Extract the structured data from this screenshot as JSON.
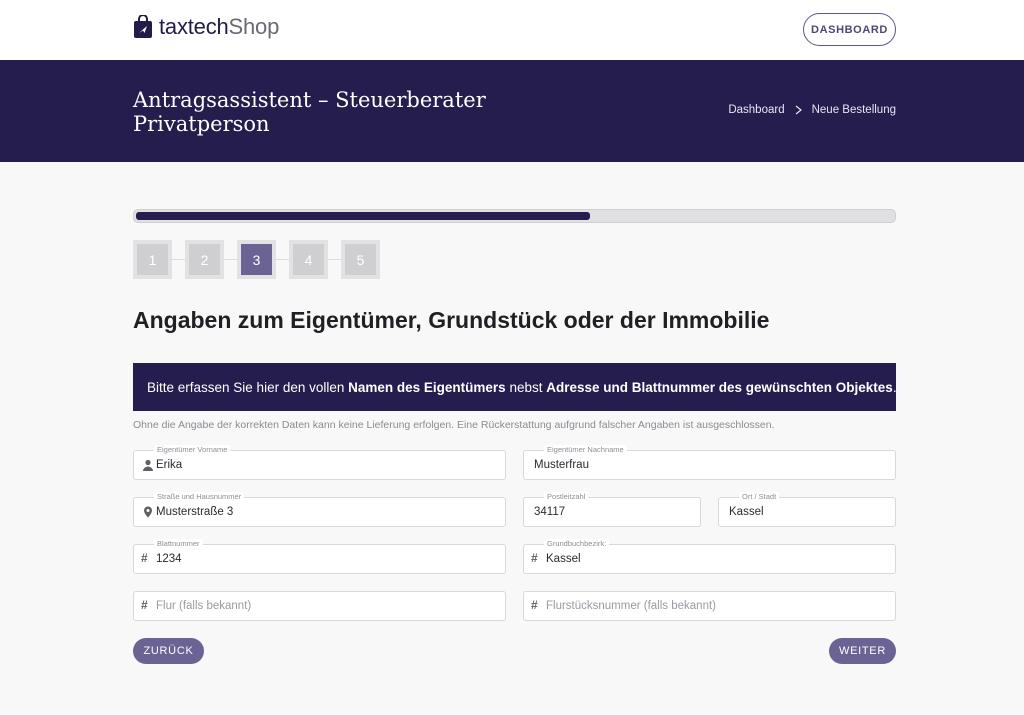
{
  "header": {
    "logo_bold": "taxtech",
    "logo_light": "Shop",
    "dashboard_button": "DASHBOARD"
  },
  "hero": {
    "title": "Antragsassistent – Steuerberater Privatperson",
    "breadcrumb": [
      "Dashboard",
      "Neue Bestellung"
    ]
  },
  "progress": {
    "fraction": 0.6
  },
  "steps": {
    "items": [
      "1",
      "2",
      "3",
      "4",
      "5"
    ],
    "active": 3
  },
  "section": {
    "title": "Angaben zum Eigentümer, Grundstück oder der Immobilie"
  },
  "info": {
    "part1": "Bitte erfassen Sie hier den vollen ",
    "bold1": "Namen des Eigentümers",
    "part2": " nebst ",
    "bold2": "Adresse und Blattnummer des gewünschten Objektes",
    "part3": "."
  },
  "note": "Ohne die Angabe der korrekten Daten kann keine Lieferung erfolgen. Eine Rückerstattung aufgrund falscher Angaben ist ausgeschlossen.",
  "form": {
    "vorname": {
      "label": "Eigentümer Vorname",
      "value": "Erika",
      "icon": "user-icon"
    },
    "nachname": {
      "label": "Eigentümer Nachname",
      "value": "Musterfrau"
    },
    "strasse": {
      "label": "Straße und Hausnummer",
      "value": "Musterstraße 3",
      "icon": "location-pin-icon"
    },
    "plz": {
      "label": "Postleitzahl",
      "value": "34117"
    },
    "ort": {
      "label": "Ort / Stadt",
      "value": "Kassel"
    },
    "blattnummer": {
      "label": "Blattnummer",
      "value": "1234",
      "icon": "hash-icon"
    },
    "grundbuchbezirk": {
      "label": "Grundbuchbezirk:",
      "value": "Kassel",
      "icon": "hash-icon"
    },
    "flur": {
      "placeholder": "Flur (falls bekannt)",
      "icon": "hash-icon"
    },
    "flurstueck": {
      "placeholder": "Flurstücksnummer (falls bekannt)",
      "icon": "hash-icon"
    }
  },
  "actions": {
    "back": "ZURÜCK",
    "next": "WEITER"
  },
  "colors": {
    "brand_dark": "#241d4e",
    "accent": "#6a6394",
    "background": "#f8f8f9"
  }
}
